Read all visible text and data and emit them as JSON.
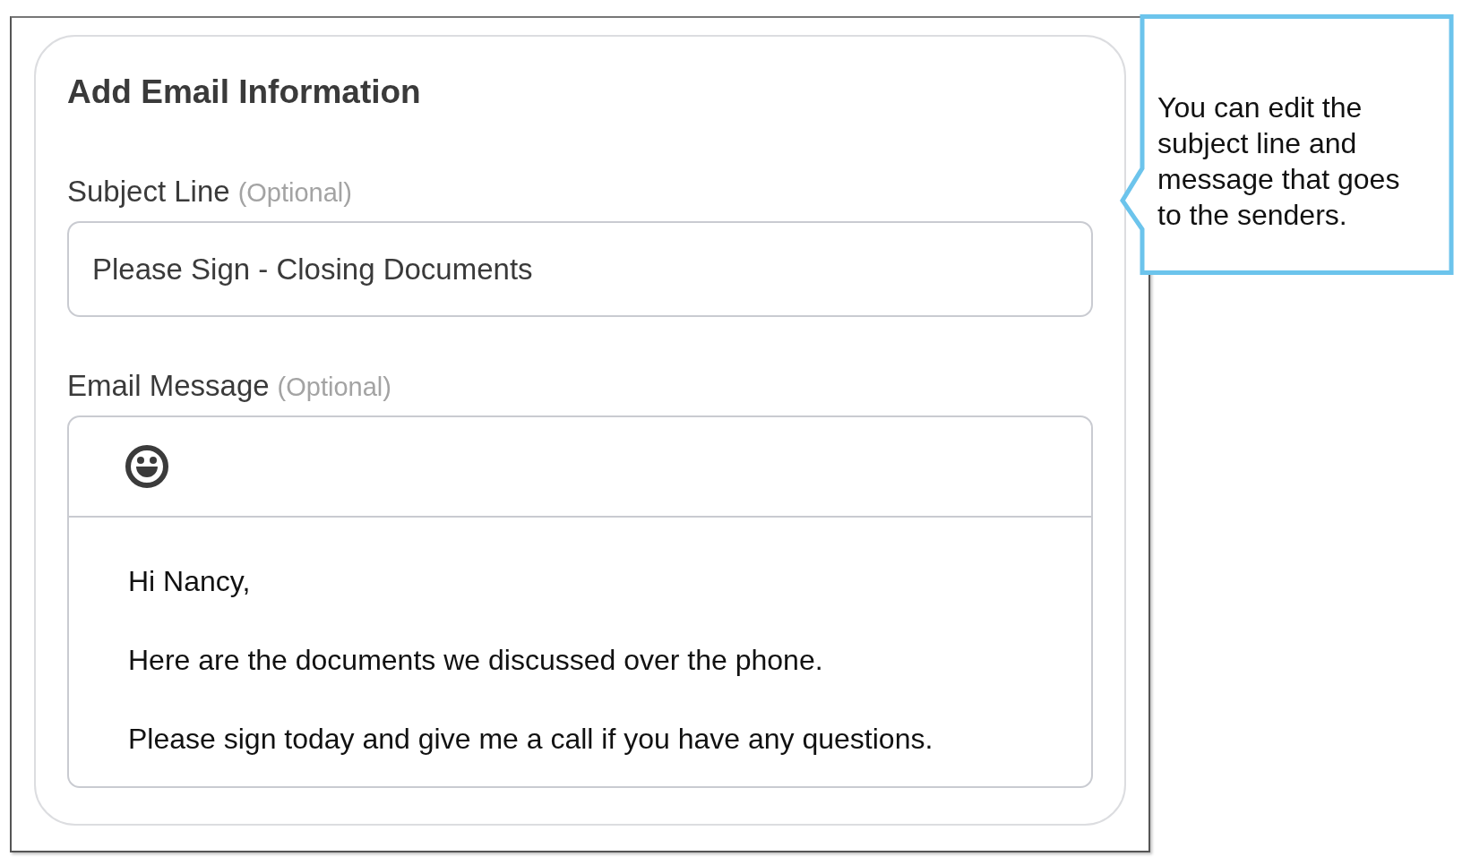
{
  "card": {
    "title": "Add Email Information"
  },
  "subject": {
    "label": "Subject Line",
    "hint": "(Optional)",
    "value": "Please Sign - Closing Documents"
  },
  "message": {
    "label": "Email Message",
    "hint": "(Optional)",
    "paragraphs": [
      "Hi Nancy,",
      "Here are the documents we discussed over the phone.",
      "Please sign today and give me a call if you have any questions."
    ]
  },
  "callout": {
    "text": "You can edit the subject line and message that goes to the senders."
  }
}
